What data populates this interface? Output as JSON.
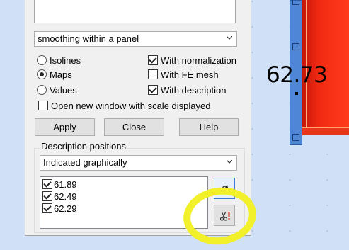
{
  "canvas": {
    "value_label": "62.73"
  },
  "panel": {
    "smoothing_select": {
      "value": "smoothing within a panel"
    },
    "display_mode": {
      "options": [
        {
          "label": "Isolines",
          "selected": false
        },
        {
          "label": "Maps",
          "selected": true
        },
        {
          "label": "Values",
          "selected": false
        }
      ]
    },
    "toggles": [
      {
        "label": "With normalization",
        "checked": true
      },
      {
        "label": "With FE mesh",
        "checked": false
      },
      {
        "label": "With description",
        "checked": true
      }
    ],
    "open_window_option": {
      "label": "Open new window with scale displayed",
      "checked": false
    },
    "buttons": {
      "apply": "Apply",
      "close": "Close",
      "help": "Help"
    },
    "description_positions": {
      "title": "Description positions",
      "select_value": "Indicated graphically",
      "items": [
        {
          "value": "61.89",
          "checked": true
        },
        {
          "value": "62.49",
          "checked": true
        },
        {
          "value": "62.29",
          "checked": true
        }
      ]
    },
    "side_icons": [
      "refresh-icon",
      "delete-icon"
    ]
  },
  "colors": {
    "highlight": "#f1f02a",
    "map_red": "#f02a12",
    "beam_blue": "#4f86d6"
  }
}
